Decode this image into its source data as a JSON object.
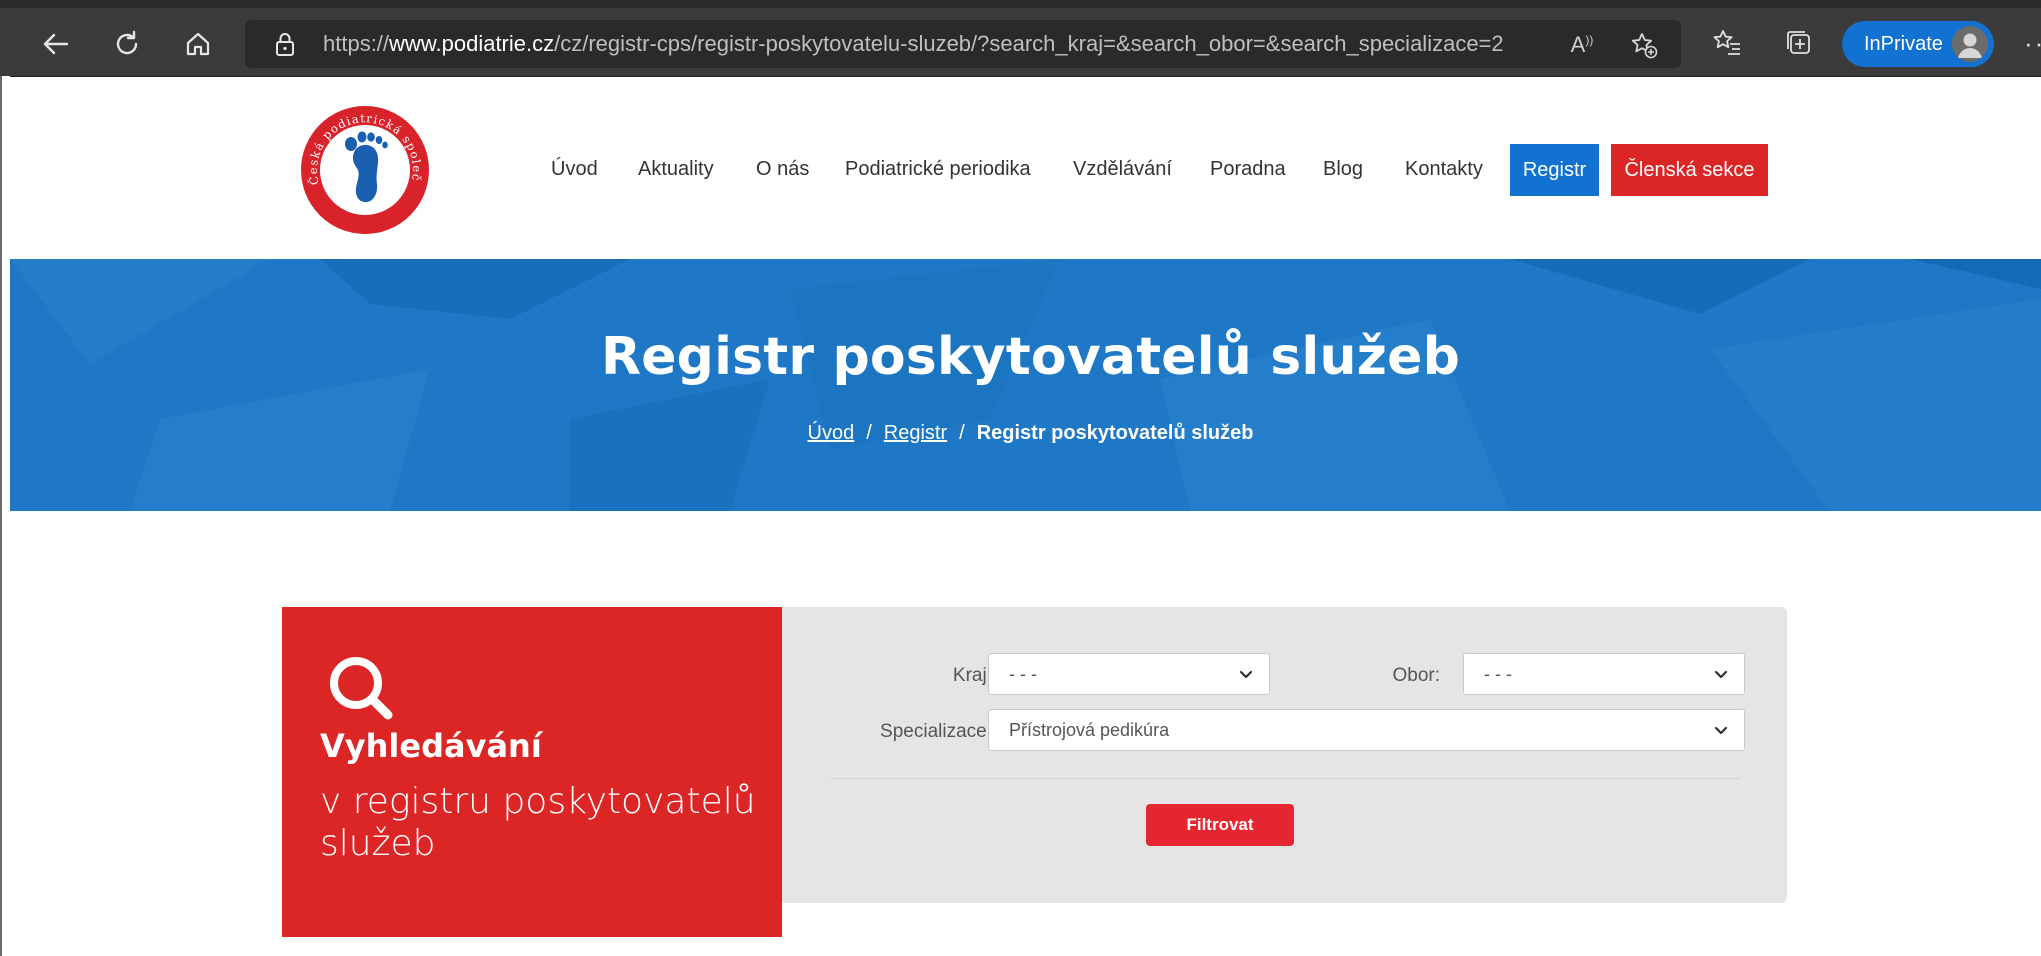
{
  "browser": {
    "url_prefix": "https://",
    "url_domain": "www.podiatrie.cz",
    "url_path": "/cz/registr-cps/registr-poskytovatelu-sluzeb/?search_kraj=&search_obor=&search_specializace=2",
    "inprivate_label": "InPrivate",
    "read_aloud_glyph": "A",
    "more_glyph": "···"
  },
  "site": {
    "logo_text": "Česká podiatrická společnost",
    "nav": {
      "items": [
        "Úvod",
        "Aktuality",
        "O nás",
        "Podiatrické periodika",
        "Vzdělávání",
        "Poradna",
        "Blog",
        "Kontakty"
      ],
      "registr": "Registr",
      "members": "Členská sekce"
    }
  },
  "hero": {
    "title": "Registr poskytovatelů služeb",
    "breadcrumb": [
      {
        "label": "Úvod"
      },
      {
        "label": "Registr"
      },
      {
        "label": "Registr poskytovatelů služeb"
      }
    ],
    "separator": "/"
  },
  "search": {
    "heading": "Vyhledávání",
    "subheading": "v registru poskytovatelů služeb",
    "kraj_label": "Kraj:",
    "kraj_value": "- - -",
    "obor_label": "Obor:",
    "obor_value": "- - -",
    "specializace_label": "Specializace:",
    "specializace_value": "Přístrojová pedikúra",
    "filter_button": "Filtrovat"
  },
  "colors": {
    "brand_blue": "#1172d1",
    "hero_blue": "#1e78c5",
    "brand_red": "#dc2626",
    "button_red": "#e52630",
    "panel_gray": "#e5e5e5"
  }
}
